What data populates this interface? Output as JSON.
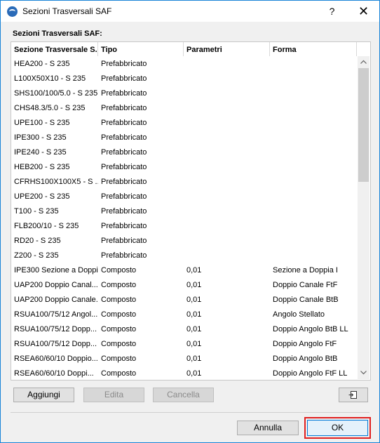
{
  "window": {
    "title": "Sezioni Trasversali SAF",
    "help_label": "?",
    "close_label": "✕"
  },
  "section_label": "Sezioni Trasversali SAF:",
  "table": {
    "columns": [
      "Sezione Trasversale S...",
      "Tipo",
      "Parametri",
      "Forma"
    ],
    "rows": [
      [
        "HEA200 - S 235",
        "Prefabbricato",
        "",
        ""
      ],
      [
        "L100X50X10 - S 235",
        "Prefabbricato",
        "",
        ""
      ],
      [
        "SHS100/100/5.0 - S 235",
        "Prefabbricato",
        "",
        ""
      ],
      [
        "CHS48.3/5.0 - S 235",
        "Prefabbricato",
        "",
        ""
      ],
      [
        "UPE100 - S 235",
        "Prefabbricato",
        "",
        ""
      ],
      [
        "IPE300 - S 235",
        "Prefabbricato",
        "",
        ""
      ],
      [
        "IPE240 - S 235",
        "Prefabbricato",
        "",
        ""
      ],
      [
        "HEB200 - S 235",
        "Prefabbricato",
        "",
        ""
      ],
      [
        "CFRHS100X100X5 - S ...",
        "Prefabbricato",
        "",
        ""
      ],
      [
        "UPE200 - S 235",
        "Prefabbricato",
        "",
        ""
      ],
      [
        "T100 - S 235",
        "Prefabbricato",
        "",
        ""
      ],
      [
        "FLB200/10 - S 235",
        "Prefabbricato",
        "",
        ""
      ],
      [
        "RD20 - S 235",
        "Prefabbricato",
        "",
        ""
      ],
      [
        "Z200 - S 235",
        "Prefabbricato",
        "",
        ""
      ],
      [
        "IPE300 Sezione a Doppi...",
        "Composto",
        "0,01",
        "Sezione a Doppia I"
      ],
      [
        "UAP200 Doppio Canal...",
        "Composto",
        "0,01",
        "Doppio Canale FtF"
      ],
      [
        "UAP200 Doppio Canale...",
        "Composto",
        "0,01",
        "Doppio Canale BtB"
      ],
      [
        "RSUA100/75/12 Angol...",
        "Composto",
        "0,01",
        "Angolo Stellato"
      ],
      [
        "RSUA100/75/12 Dopp...",
        "Composto",
        "0,01",
        "Doppio Angolo BtB LL"
      ],
      [
        "RSUA100/75/12 Dopp...",
        "Composto",
        "0,01",
        "Doppio Angolo FtF"
      ],
      [
        "RSEA60/60/10 Doppio...",
        "Composto",
        "0,01",
        "Doppio Angolo BtB"
      ],
      [
        "RSEA60/60/10 Doppi...",
        "Composto",
        "0,01",
        "Doppio Angolo FtF LL"
      ]
    ]
  },
  "scrollbar": {
    "up_icon": "chevron-up-icon",
    "down_icon": "chevron-down-icon"
  },
  "buttons": {
    "add": "Aggiungi",
    "edit": "Edita",
    "delete": "Cancella",
    "export_icon": "export-icon",
    "cancel": "Annulla",
    "ok": "OK"
  },
  "colors": {
    "window_border": "#1883d7",
    "highlight_outline": "#e02020",
    "ok_border": "#0078d7"
  }
}
